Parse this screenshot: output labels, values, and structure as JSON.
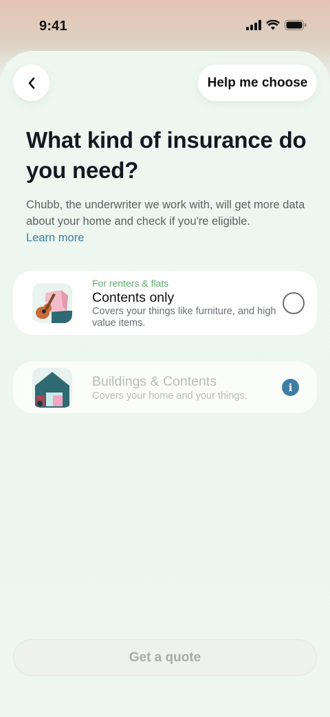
{
  "status_bar": {
    "time": "9:41"
  },
  "header": {
    "back_icon": "chevron-left-icon",
    "help_label": "Help me choose"
  },
  "main": {
    "title": "What kind of insurance do you need?",
    "description": "Chubb, the underwriter we work with, will get more data about your home and check if you're eligible.",
    "learn_more": "Learn more",
    "options": [
      {
        "tag": "For renters & flats",
        "title": "Contents only",
        "subtitle": "Covers your things like furniture, and high value items.",
        "control": "radio-unselected"
      },
      {
        "title": "Buildings & Contents",
        "subtitle": "Covers your home and your things.",
        "control": "info-icon",
        "info_glyph": "i"
      }
    ]
  },
  "footer": {
    "quote_label": "Get a quote"
  },
  "colors": {
    "accent": "#3d7ea5",
    "tag_green": "#5eaa6a",
    "background": "#eef6f0"
  }
}
